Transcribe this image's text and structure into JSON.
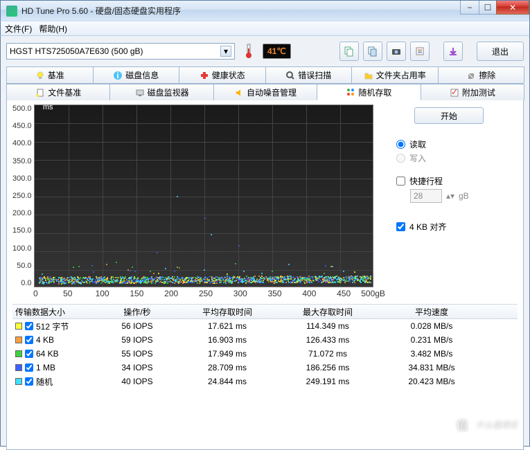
{
  "window": {
    "title": "HD Tune Pro 5.60 - 硬盘/固态硬盘实用程序"
  },
  "menu": {
    "file": "文件(F)",
    "help": "帮助(H)"
  },
  "toolbar": {
    "drive": "HGST HTS725050A7E630 (500 gB)",
    "temp": "41℃",
    "exit": "退出"
  },
  "tabs_row1": [
    {
      "label": "基准",
      "icon": "bulb"
    },
    {
      "label": "磁盘信息",
      "icon": "info"
    },
    {
      "label": "健康状态",
      "icon": "health"
    },
    {
      "label": "错误扫描",
      "icon": "search"
    },
    {
      "label": "文件夹占用率",
      "icon": "folder"
    },
    {
      "label": "擦除",
      "icon": "erase"
    }
  ],
  "tabs_row2": [
    {
      "label": "文件基准",
      "icon": "filebench"
    },
    {
      "label": "磁盘监视器",
      "icon": "monitor"
    },
    {
      "label": "自动噪音管理",
      "icon": "sound"
    },
    {
      "label": "随机存取",
      "icon": "random",
      "active": true
    },
    {
      "label": "附加测试",
      "icon": "extra"
    }
  ],
  "side": {
    "start": "开始",
    "read": "读取",
    "write": "写入",
    "shortstroke": "快捷行程",
    "size": "28",
    "sizeunit": "gB",
    "align": "4 KB 对齐"
  },
  "chart_data": {
    "type": "scatter",
    "xlabel": "",
    "ylabel": "ms",
    "xlim": [
      0,
      500
    ],
    "ylim": [
      0,
      500
    ],
    "xunit": "gB",
    "x_ticks": [
      0,
      50,
      100,
      150,
      200,
      250,
      300,
      350,
      400,
      450,
      500
    ],
    "y_ticks": [
      0,
      50,
      100,
      150,
      200,
      250,
      300,
      350,
      400,
      450,
      500
    ],
    "series": [
      {
        "name": "512 字节",
        "color": "#ffff40",
        "note": "dense band ~5-25ms across 0-500gB"
      },
      {
        "name": "4 KB",
        "color": "#ffa040",
        "note": "dense band ~5-25ms across 0-500gB"
      },
      {
        "name": "64 KB",
        "color": "#40d040",
        "note": "dense band ~5-25ms, outliers up to ~70ms"
      },
      {
        "name": "1 MB",
        "color": "#4060ff",
        "note": "band ~10-35ms, outliers up to ~185ms"
      },
      {
        "name": "随机",
        "color": "#40e0ff",
        "note": "band ~10-30ms, outliers up to ~250ms"
      }
    ]
  },
  "results": {
    "headers": [
      "传输数据大小",
      "操作/秒",
      "平均存取时间",
      "最大存取时间",
      "平均速度"
    ],
    "rows": [
      {
        "color": "#ffff40",
        "label": "512 字节",
        "iops": "56 IOPS",
        "avg": "17.621 ms",
        "max": "114.349 ms",
        "speed": "0.028 MB/s"
      },
      {
        "color": "#ffa040",
        "label": "4 KB",
        "iops": "59 IOPS",
        "avg": "16.903 ms",
        "max": "126.433 ms",
        "speed": "0.231 MB/s"
      },
      {
        "color": "#40d040",
        "label": "64 KB",
        "iops": "55 IOPS",
        "avg": "17.949 ms",
        "max": "71.072 ms",
        "speed": "3.482 MB/s"
      },
      {
        "color": "#4060ff",
        "label": "1 MB",
        "iops": "34 IOPS",
        "avg": "28.709 ms",
        "max": "186.256 ms",
        "speed": "34.831 MB/s"
      },
      {
        "color": "#40e0ff",
        "label": "随机",
        "iops": "40 IOPS",
        "avg": "24.844 ms",
        "max": "249.191 ms",
        "speed": "20.423 MB/s"
      }
    ]
  },
  "watermark": "什么值得买"
}
